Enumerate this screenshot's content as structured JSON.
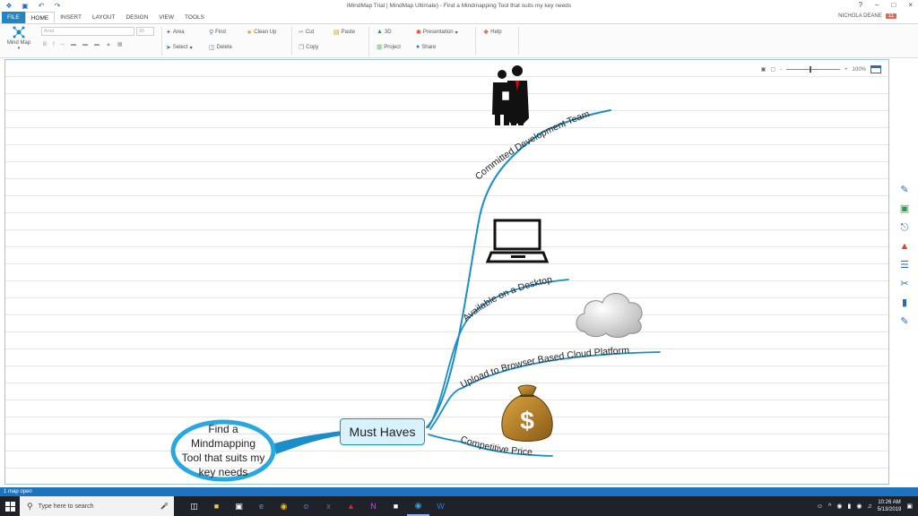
{
  "window": {
    "title": "iMindMap Trial | MindMap Ultimate) - Find a Mindmapping Tool that suits my key needs",
    "controls": [
      "?",
      "–",
      "□",
      "×"
    ]
  },
  "tabs": [
    "FILE",
    "HOME",
    "INSERT",
    "LAYOUT",
    "DESIGN",
    "VIEW",
    "TOOLS"
  ],
  "active_tab": "HOME",
  "user": {
    "name": "NICHOLA DEANE",
    "badge": "11"
  },
  "ribbon": {
    "mindmap": "Mind Map",
    "font_name": "Arial",
    "font_size": "26",
    "area": "Area",
    "select": "Select",
    "find": "Find",
    "delete": "Delete",
    "clean_up": "Clean Up",
    "cut": "Cut",
    "copy": "Copy",
    "paste": "Paste",
    "three_d": "3D",
    "project": "Project",
    "presentation": "Presentation",
    "share": "Share",
    "help": "Help"
  },
  "canvas": {
    "zoom": "100%",
    "central_idea": "Find a Mindmapping Tool that suits my key needs",
    "central_lines": [
      "Find a",
      "Mindmapping",
      "Tool that suits my",
      "key needs"
    ],
    "main_branch": "Must Haves",
    "branches": [
      {
        "label": "Committed Development Team",
        "image": "business-people"
      },
      {
        "label": "Available on a Desktop",
        "image": "laptop"
      },
      {
        "label": "Upload to Browser Based Cloud Platform",
        "image": "cloud"
      },
      {
        "label": "Competitive Price",
        "image": "money-bag"
      }
    ],
    "colors": {
      "branch": "#1b8ec9",
      "central": "#29a8e0",
      "node_fill": "#d9f1fb"
    }
  },
  "sidebar_tools": [
    "note-icon",
    "image-icon",
    "attachment-icon",
    "shapes-icon",
    "list-icon",
    "branch-icon",
    "tag-icon",
    "format-paint-icon"
  ],
  "status": {
    "text": "1 map open"
  },
  "taskbar": {
    "search_placeholder": "Type here to search",
    "time": "10:26 AM",
    "date": "5/13/2019"
  }
}
